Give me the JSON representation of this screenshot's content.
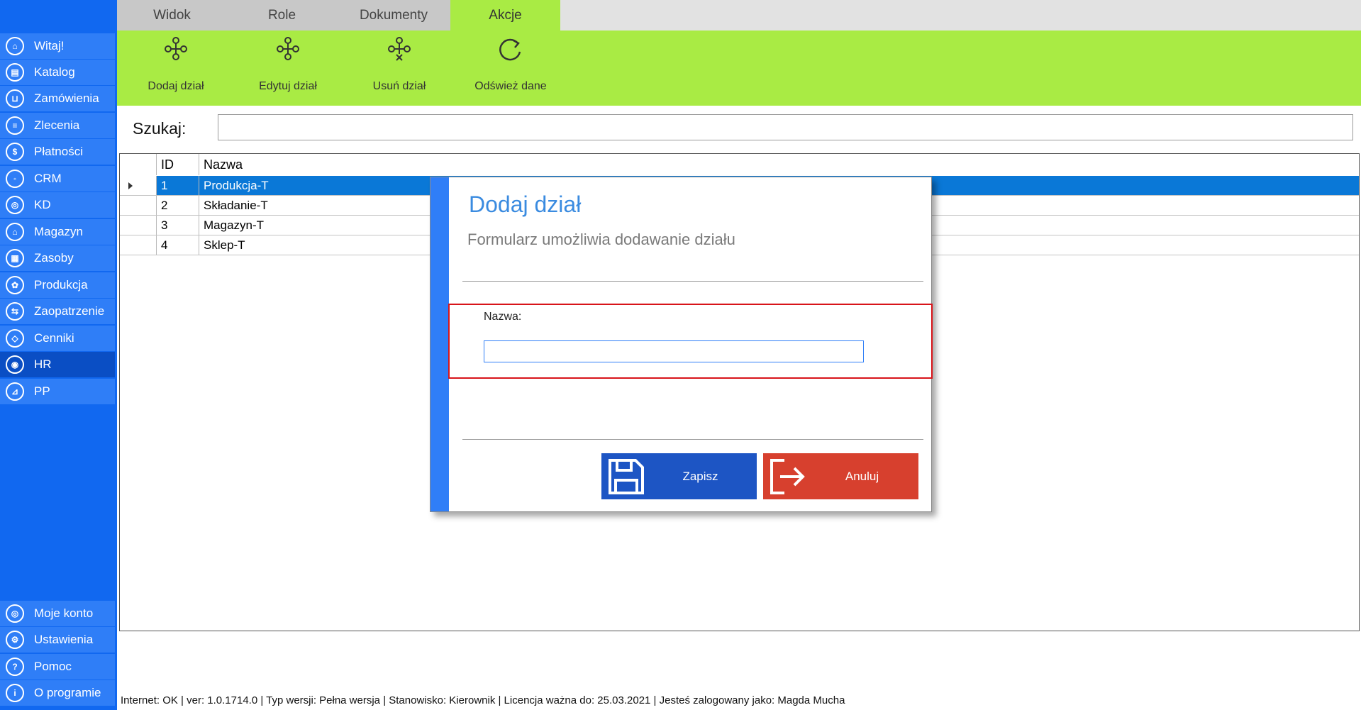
{
  "sidebar": {
    "items": [
      {
        "label": "Witaj!",
        "icon": "home-icon",
        "glyph": "⌂"
      },
      {
        "label": "Katalog",
        "icon": "book-icon",
        "glyph": "▤"
      },
      {
        "label": "Zamówienia",
        "icon": "cart-icon",
        "glyph": "⊔"
      },
      {
        "label": "Zlecenia",
        "icon": "list-icon",
        "glyph": "≡"
      },
      {
        "label": "Płatności",
        "icon": "dollar-icon",
        "glyph": "$"
      },
      {
        "label": "CRM",
        "icon": "crm-icon",
        "glyph": "◦"
      },
      {
        "label": "KD",
        "icon": "person-icon",
        "glyph": "◎"
      },
      {
        "label": "Magazyn",
        "icon": "warehouse-icon",
        "glyph": "⌂"
      },
      {
        "label": "Zasoby",
        "icon": "box-icon",
        "glyph": "▦"
      },
      {
        "label": "Produkcja",
        "icon": "production-icon",
        "glyph": "✿"
      },
      {
        "label": "Zaopatrzenie",
        "icon": "truck-icon",
        "glyph": "⇆"
      },
      {
        "label": "Cenniki",
        "icon": "tag-icon",
        "glyph": "◇"
      },
      {
        "label": "HR",
        "icon": "hr-icon",
        "glyph": "◉"
      },
      {
        "label": "PP",
        "icon": "pp-icon",
        "glyph": "⊿"
      }
    ],
    "bottom_items": [
      {
        "label": "Moje konto",
        "icon": "account-icon",
        "glyph": "◎"
      },
      {
        "label": "Ustawienia",
        "icon": "settings-icon",
        "glyph": "⚙"
      },
      {
        "label": "Pomoc",
        "icon": "help-icon",
        "glyph": "?"
      },
      {
        "label": "O programie",
        "icon": "info-icon",
        "glyph": "i"
      }
    ],
    "active": "HR"
  },
  "tabs": [
    {
      "label": "Widok"
    },
    {
      "label": "Role"
    },
    {
      "label": "Dokumenty"
    },
    {
      "label": "Akcje"
    }
  ],
  "active_tab": "Akcje",
  "ribbon": {
    "buttons": [
      {
        "label": "Dodaj dział",
        "icon": "add-department-icon"
      },
      {
        "label": "Edytuj dział",
        "icon": "edit-department-icon"
      },
      {
        "label": "Usuń dział",
        "icon": "delete-department-icon"
      },
      {
        "label": "Odśwież dane",
        "icon": "refresh-icon"
      }
    ]
  },
  "search": {
    "label": "Szukaj:",
    "value": ""
  },
  "grid": {
    "columns": [
      "ID",
      "Nazwa"
    ],
    "rows": [
      {
        "id": "1",
        "name": "Produkcja-T",
        "selected": true
      },
      {
        "id": "2",
        "name": "Składanie-T",
        "selected": false
      },
      {
        "id": "3",
        "name": "Magazyn-T",
        "selected": false
      },
      {
        "id": "4",
        "name": "Sklep-T",
        "selected": false
      }
    ]
  },
  "dialog": {
    "title": "Dodaj dział",
    "subtitle": "Formularz umożliwia dodawanie działu",
    "field_label": "Nazwa:",
    "field_value": "",
    "save_label": "Zapisz",
    "cancel_label": "Anuluj"
  },
  "statusbar": {
    "text": "Internet: OK  |   ver: 1.0.1714.0   |   Typ wersji: Pełna wersja   |   Stanowisko: Kierownik   |   Licencja ważna do: 25.03.2021   |   Jesteś zalogowany jako: Magda Mucha"
  },
  "colors": {
    "sidebar": "#1168f0",
    "ribbon": "#a9eb44",
    "selected_row": "#0a78d7",
    "save_button": "#1d55c4",
    "cancel_button": "#d7402e",
    "highlight_box": "#d8141a"
  }
}
